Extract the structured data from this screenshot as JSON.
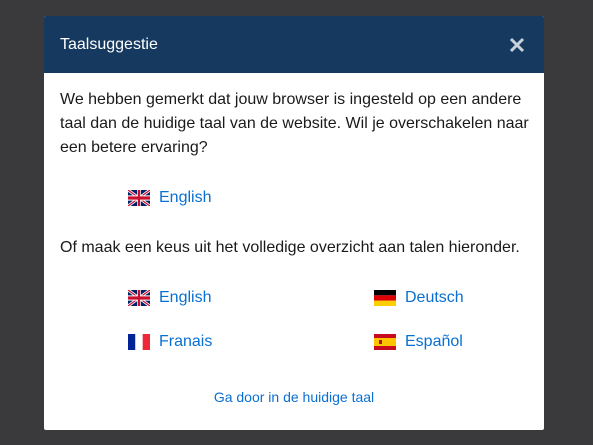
{
  "modal": {
    "title": "Taalsuggestie",
    "close_icon": "close-icon",
    "intro_text": "We hebben gemerkt dat jouw browser is ingesteld op een andere taal dan de huidige taal van de website. Wil je overschakelen naar een betere ervaring?",
    "suggested_language": {
      "label": "English",
      "flag_icon": "uk-flag-icon"
    },
    "overview_text": "Of maak een keus uit het volledige overzicht aan talen hieronder.",
    "languages": [
      {
        "label": "English",
        "flag_icon": "uk-flag-icon"
      },
      {
        "label": "Deutsch",
        "flag_icon": "germany-flag-icon"
      },
      {
        "label": "Franais",
        "flag_icon": "france-flag-icon"
      },
      {
        "label": "Español",
        "flag_icon": "spain-flag-icon"
      }
    ],
    "continue_label": "Ga door in de huidige taal"
  },
  "colors": {
    "backdrop": "#3a3a3c",
    "header": "#163a5f",
    "link": "#0a6fd1",
    "text": "#1a1a1a"
  }
}
